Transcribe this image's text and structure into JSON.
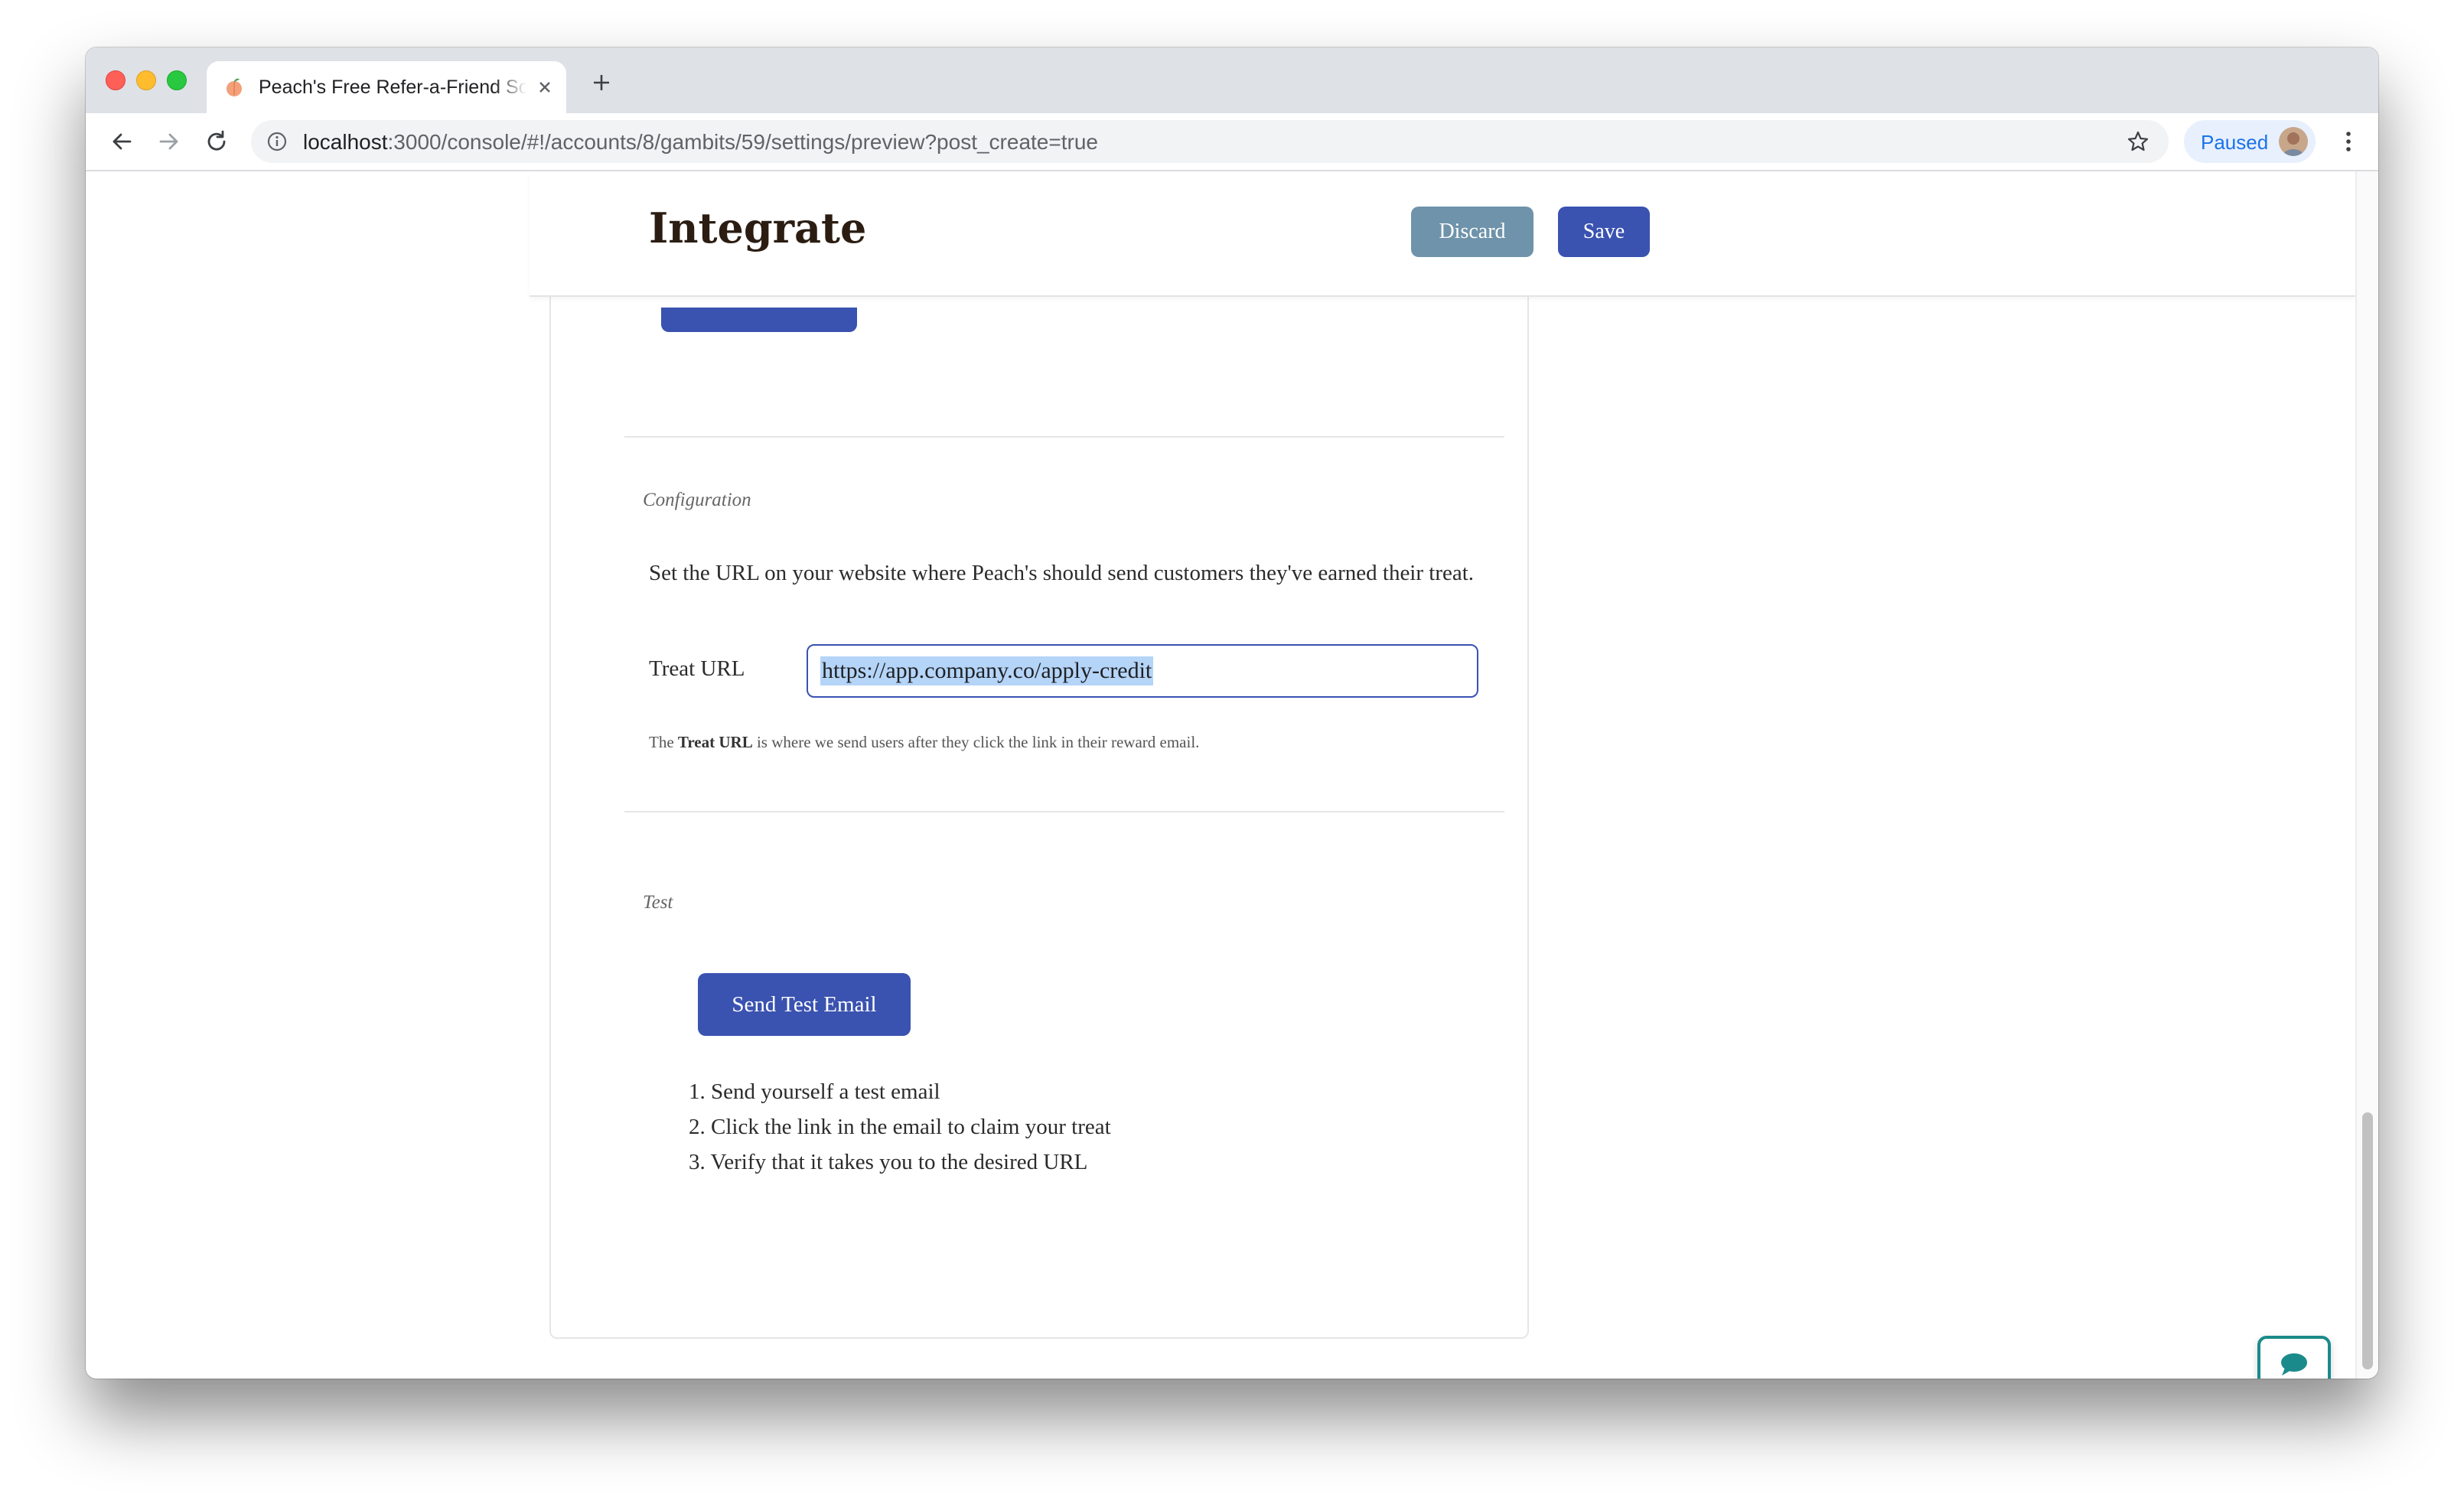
{
  "browser": {
    "tab_title": "Peach's Free Refer-a-Friend Software",
    "url_host": "localhost",
    "url_path": ":3000/console/#!/accounts/8/gambits/59/settings/preview?post_create=true",
    "profile_status": "Paused"
  },
  "header": {
    "title": "Integrate",
    "discard_label": "Discard",
    "save_label": "Save"
  },
  "configuration": {
    "section_label": "Configuration",
    "description": "Set the URL on your website where Peach's should send customers they've earned their treat.",
    "field_label": "Treat URL",
    "treat_url": "https://app.company.co/apply-credit",
    "help_prefix": "The ",
    "help_bold": "Treat URL",
    "help_suffix": " is where we send users after they click the link in their reward email."
  },
  "test": {
    "section_label": "Test",
    "button_label": "Send Test Email",
    "steps": [
      "Send yourself a test email",
      "Click the link in the email to claim your treat",
      "Verify that it takes you to the desired URL"
    ]
  },
  "colors": {
    "primary": "#3a52b0",
    "discard": "#6e93aa",
    "chat_accent": "#1b8a8a",
    "selection": "#b4d4f8"
  },
  "icons": [
    "info-icon",
    "star-icon",
    "chat-bubble-icon",
    "back-arrow-icon",
    "forward-arrow-icon",
    "reload-icon",
    "close-icon",
    "plus-icon",
    "peach-icon",
    "menu-dots-icon"
  ]
}
